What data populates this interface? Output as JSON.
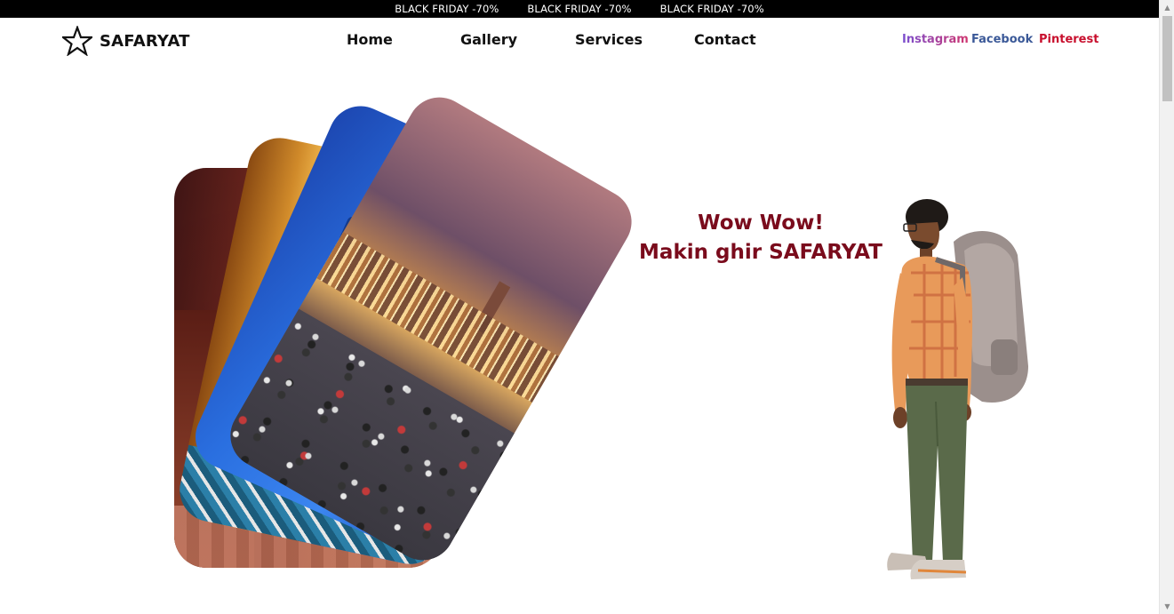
{
  "promo": {
    "items": [
      "BLACK FRIDAY -70%",
      "BLACK FRIDAY -70%",
      "BLACK FRIDAY -70%"
    ]
  },
  "brand": {
    "name": "SAFARYAT",
    "icon": "star-outline-icon"
  },
  "nav": {
    "items": [
      {
        "label": "Home"
      },
      {
        "label": "Gallery"
      },
      {
        "label": "Services"
      },
      {
        "label": "Contact"
      }
    ]
  },
  "social": {
    "items": [
      {
        "label": "Instagram",
        "color": "#8a4fc7"
      },
      {
        "label": "Facebook",
        "color": "#3b5998"
      },
      {
        "label": "Pinterest",
        "color": "#c8102e"
      }
    ]
  },
  "hero": {
    "line1": "Wow Wow!",
    "line2": "Makin ghir SAFARYAT",
    "color": "#7a0b1c",
    "cards": [
      {
        "subject": "marrakech-square-photo"
      },
      {
        "subject": "blue-door-photo"
      },
      {
        "subject": "carved-wooden-door-photo"
      },
      {
        "subject": "moroccan-arches-photo"
      }
    ],
    "illustration": "backpacker-traveler-illustration"
  }
}
